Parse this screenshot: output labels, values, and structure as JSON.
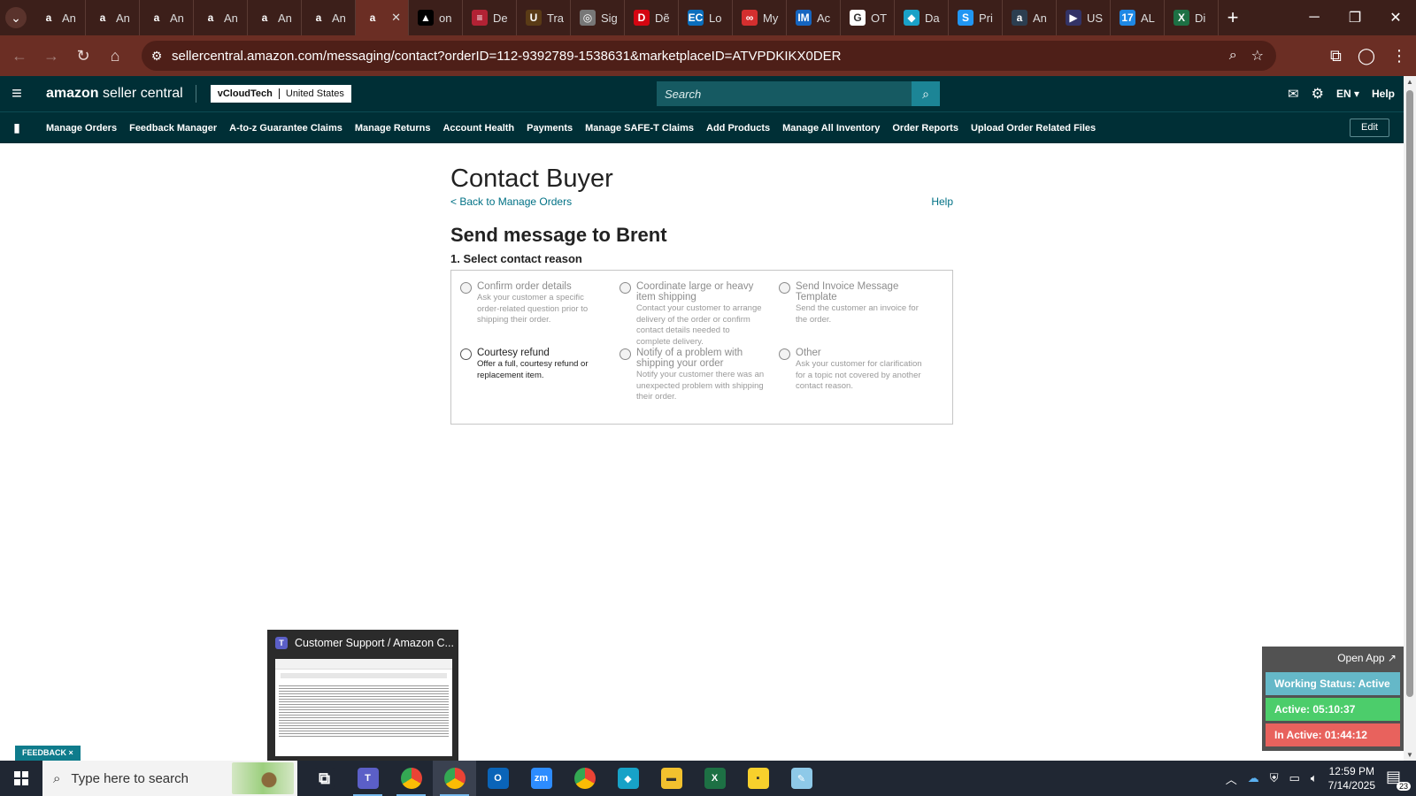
{
  "browser": {
    "tabs": [
      {
        "title": "An",
        "icon": "amazon-icon",
        "color": "#111111",
        "glyph": "a"
      },
      {
        "title": "An",
        "icon": "amazon-icon",
        "color": "#111111",
        "glyph": "a"
      },
      {
        "title": "An",
        "icon": "amazon-icon",
        "color": "#111111",
        "glyph": "a"
      },
      {
        "title": "An",
        "icon": "amazon-icon",
        "color": "#111111",
        "glyph": "a"
      },
      {
        "title": "An",
        "icon": "amazon-icon",
        "color": "#111111",
        "glyph": "a"
      },
      {
        "title": "An",
        "icon": "amazon-icon",
        "color": "#111111",
        "glyph": "a"
      },
      {
        "title": "",
        "icon": "amazon-icon",
        "color": "#111111",
        "glyph": "a",
        "active": true
      },
      {
        "title": "on",
        "icon": "triangle-icon",
        "color": "#000000",
        "glyph": "▲"
      },
      {
        "title": "De",
        "icon": "flag-icon",
        "color": "#b22234",
        "glyph": "≡"
      },
      {
        "title": "Tra",
        "icon": "ups-icon",
        "color": "#5a3b16",
        "glyph": "U"
      },
      {
        "title": "Sig",
        "icon": "globe-icon",
        "color": "#777777",
        "glyph": "◎"
      },
      {
        "title": "Dẽ",
        "icon": "dhl-icon",
        "color": "#d40511",
        "glyph": "D"
      },
      {
        "title": "Lo",
        "icon": "ec-icon",
        "color": "#0a6ebd",
        "glyph": "EC"
      },
      {
        "title": "My",
        "icon": "link-icon",
        "color": "#d32f2f",
        "glyph": "∞"
      },
      {
        "title": "Ac",
        "icon": "im-icon",
        "color": "#1565c0",
        "glyph": "IM"
      },
      {
        "title": "OT",
        "icon": "google-icon",
        "color": "#ffffff",
        "glyph": "G"
      },
      {
        "title": "Da",
        "icon": "diamond-icon",
        "color": "#1aa1c7",
        "glyph": "◆"
      },
      {
        "title": "Pri",
        "icon": "s-icon",
        "color": "#2196f3",
        "glyph": "S"
      },
      {
        "title": "An",
        "icon": "amazon-icon",
        "color": "#2c3e50",
        "glyph": "a"
      },
      {
        "title": "US",
        "icon": "usps-icon",
        "color": "#333366",
        "glyph": "▶"
      },
      {
        "title": "AL",
        "icon": "17track-icon",
        "color": "#1e88e5",
        "glyph": "17"
      },
      {
        "title": "Di",
        "icon": "excel-icon",
        "color": "#1d7044",
        "glyph": "X"
      }
    ],
    "url": "sellercentral.amazon.com/messaging/contact?orderID=112-9392789-1538631&marketplaceID=ATVPDKIKX0DER"
  },
  "header": {
    "logo_bold": "amazon",
    "logo_light": " seller central",
    "account_name": "vCloudTech",
    "marketplace": "United States",
    "search_placeholder": "Search",
    "language": "EN",
    "help": "Help"
  },
  "nav": {
    "items": [
      "Manage Orders",
      "Feedback Manager",
      "A-to-z Guarantee Claims",
      "Manage Returns",
      "Account Health",
      "Payments",
      "Manage SAFE-T Claims",
      "Add Products",
      "Manage All Inventory",
      "Order Reports",
      "Upload Order Related Files"
    ],
    "edit": "Edit"
  },
  "main": {
    "title": "Contact Buyer",
    "back_link": "< Back to Manage Orders",
    "help_link": "Help",
    "message_title": "Send message to Brent",
    "step_label": "1. Select contact reason",
    "reasons": [
      {
        "label": "Confirm order details",
        "desc": "Ask your customer a specific order-related question prior to shipping their order.",
        "enabled": false
      },
      {
        "label": "Coordinate large or heavy item shipping",
        "desc": "Contact your customer to arrange delivery of the order or confirm contact details needed to complete delivery.",
        "enabled": false
      },
      {
        "label": "Send Invoice Message Template",
        "desc": "Send the customer an invoice for the order.",
        "enabled": false
      },
      {
        "label": "Courtesy refund",
        "desc": "Offer a full, courtesy refund or replacement item.",
        "enabled": true
      },
      {
        "label": "Notify of a problem with shipping your order",
        "desc": "Notify your customer there was an unexpected problem with shipping their order.",
        "enabled": false
      },
      {
        "label": "Other",
        "desc": "Ask your customer for clarification for a topic not covered by another contact reason.",
        "enabled": false
      }
    ]
  },
  "preview": {
    "title": "Customer Support / Amazon C..."
  },
  "feedback": {
    "label": "FEEDBACK",
    "close": "×"
  },
  "widget": {
    "open_app": "Open App ↗",
    "status": "Working Status: Active",
    "active": "Active: 05:10:37",
    "inactive": "In Active: 01:44:12"
  },
  "taskbar": {
    "search_placeholder": "Type here to search",
    "apps": [
      {
        "name": "task-view-icon",
        "color": "#202733",
        "glyph": "⧉",
        "open": false
      },
      {
        "name": "teams-icon",
        "color": "#5b5fc7",
        "glyph": "T",
        "open": true
      },
      {
        "name": "chrome-icon",
        "color": "#e33b2e",
        "glyph": "●",
        "open": true
      },
      {
        "name": "chrome-profile-icon",
        "color": "#e33b2e",
        "glyph": "●",
        "open": true,
        "highlight": true
      },
      {
        "name": "outlook-icon",
        "color": "#0a64b8",
        "glyph": "O",
        "open": false
      },
      {
        "name": "zoom-icon",
        "color": "#2d8cff",
        "glyph": "zm",
        "open": false
      },
      {
        "name": "chrome-alt-icon",
        "color": "#e33b2e",
        "glyph": "●",
        "open": false
      },
      {
        "name": "kodi-icon",
        "color": "#17a2c7",
        "glyph": "◆",
        "open": false
      },
      {
        "name": "file-explorer-icon",
        "color": "#f2c12e",
        "glyph": "▬",
        "open": false
      },
      {
        "name": "excel-icon",
        "color": "#1d7044",
        "glyph": "X",
        "open": false
      },
      {
        "name": "sticky-notes-icon",
        "color": "#f7d02c",
        "glyph": "▪",
        "open": false
      },
      {
        "name": "notepad-icon",
        "color": "#8ec9e8",
        "glyph": "✎",
        "open": false
      }
    ],
    "time": "12:59 PM",
    "date": "7/14/2025",
    "notifications": "23"
  }
}
